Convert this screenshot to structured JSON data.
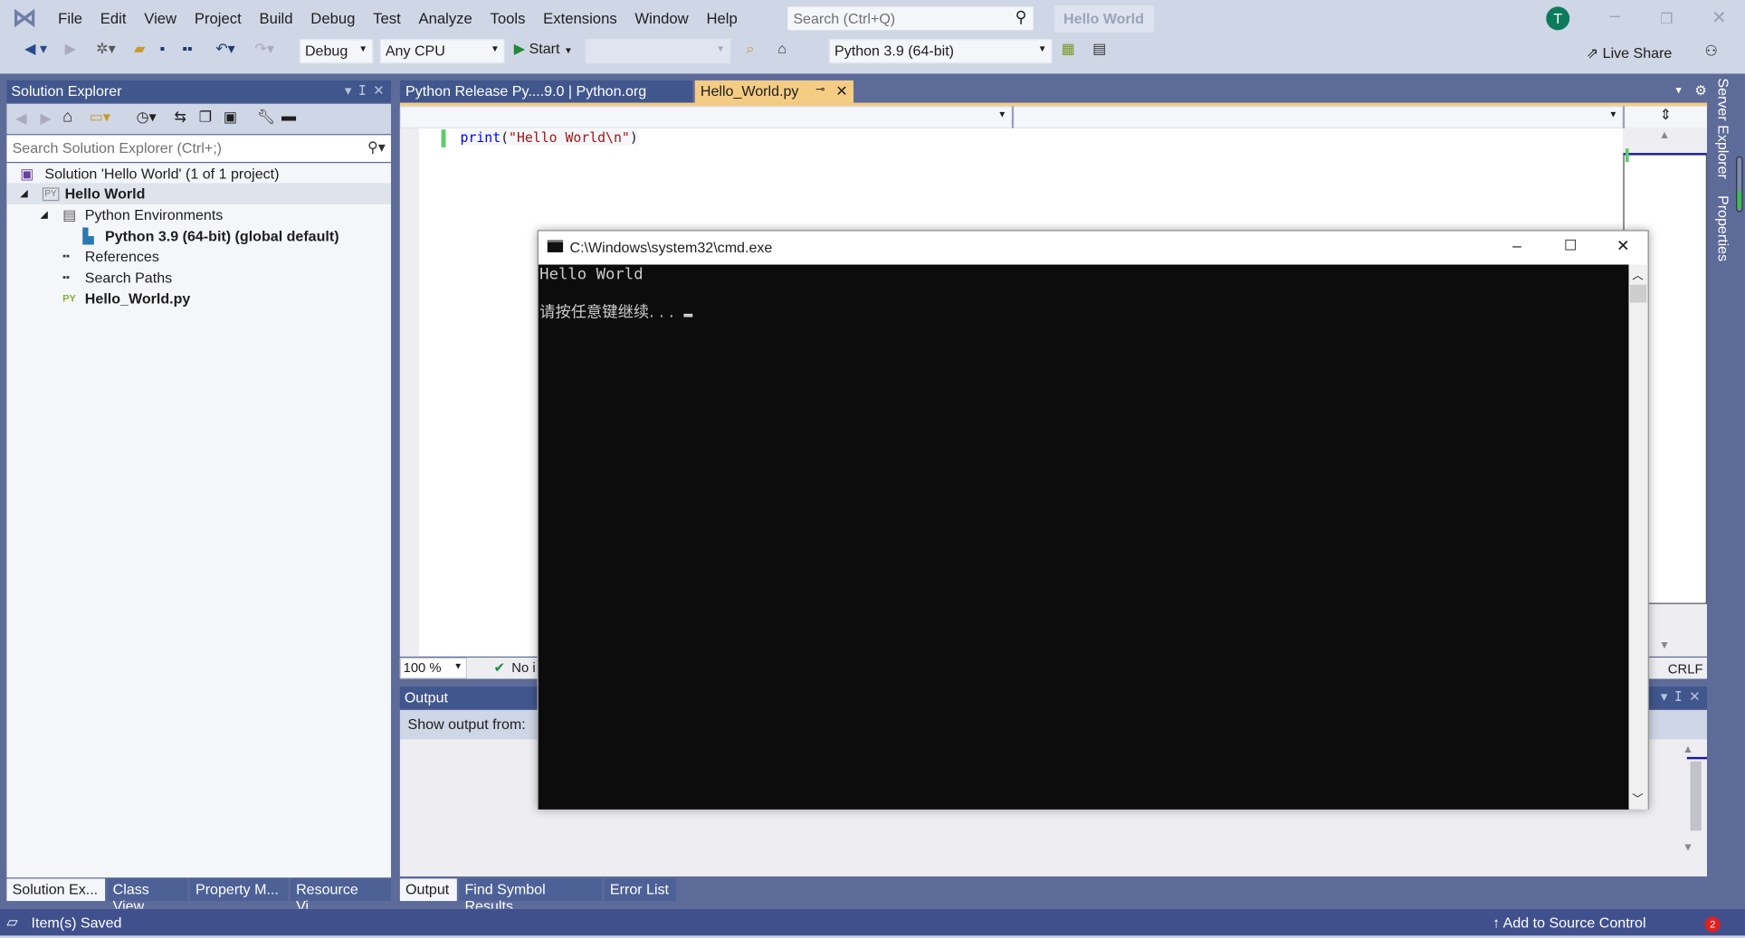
{
  "menu": {
    "items": [
      "File",
      "Edit",
      "View",
      "Project",
      "Build",
      "Debug",
      "Test",
      "Analyze",
      "Tools",
      "Extensions",
      "Window",
      "Help"
    ]
  },
  "search": {
    "placeholder": "Search (Ctrl+Q)"
  },
  "window_title": "Hello World",
  "user_initial": "T",
  "toolbar": {
    "config": "Debug",
    "platform": "Any CPU",
    "start_label": "Start",
    "environment": "Python 3.9 (64-bit)",
    "live_share": "Live Share"
  },
  "solution_explorer": {
    "title": "Solution Explorer",
    "search_placeholder": "Search Solution Explorer (Ctrl+;)",
    "tree": [
      {
        "label": "Solution 'Hello World' (1 of 1 project)",
        "icon": "solution-icon"
      },
      {
        "label": "Hello World",
        "icon": "python-project-icon",
        "bold": true,
        "expanded": true
      },
      {
        "label": "Python Environments",
        "icon": "environments-icon",
        "expanded": true
      },
      {
        "label": "Python 3.9 (64-bit) (global default)",
        "icon": "python-env-icon",
        "bold": true
      },
      {
        "label": "References",
        "icon": "references-icon"
      },
      {
        "label": "Search Paths",
        "icon": "search-paths-icon"
      },
      {
        "label": "Hello_World.py",
        "icon": "python-file-icon",
        "bold": true
      }
    ],
    "bottom_tabs": [
      "Solution Ex...",
      "Class View",
      "Property M...",
      "Resource Vi..."
    ]
  },
  "editor": {
    "tabs": [
      {
        "label": "Python Release Py....9.0 | Python.org",
        "active": false
      },
      {
        "label": "Hello_World.py",
        "active": true
      }
    ],
    "code": {
      "func": "print",
      "open": "(",
      "string": "\"Hello World\\n\"",
      "close": ")"
    },
    "zoom": "100 %",
    "issues": "No i",
    "line_ending": "CRLF"
  },
  "output": {
    "title": "Output",
    "show_from_label": "Show output from:",
    "bottom_tabs": [
      "Output",
      "Find Symbol Results",
      "Error List"
    ]
  },
  "side_tabs": [
    "Server Explorer",
    "Properties"
  ],
  "status": {
    "message": "Item(s) Saved",
    "source_control": "Add to Source Control",
    "notifications": "2"
  },
  "cmd": {
    "title": "C:\\Windows\\system32\\cmd.exe",
    "lines": [
      "Hello World",
      "请按任意键继续. . . "
    ]
  },
  "colors": {
    "accent": "#40568d",
    "active_tab": "#f5cc84",
    "status_bar": "#40508d"
  }
}
